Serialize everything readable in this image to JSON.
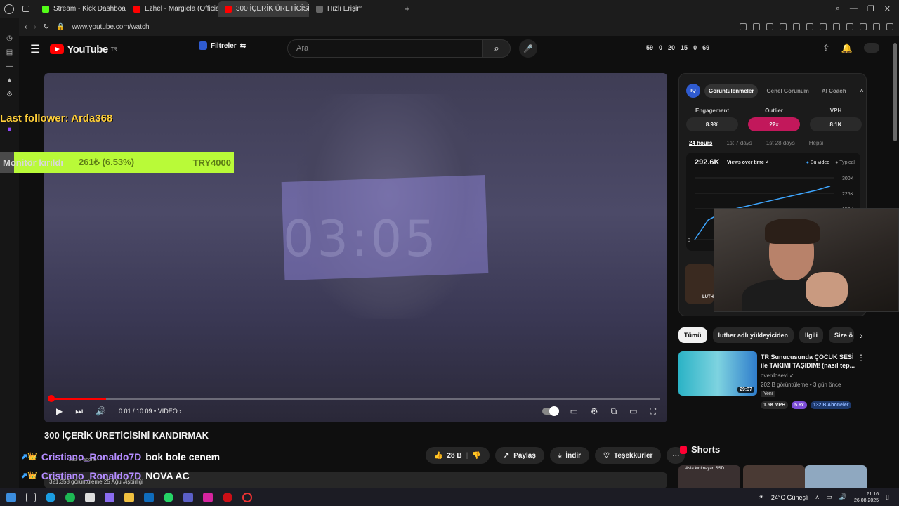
{
  "browser": {
    "tabs": [
      {
        "label": "Stream - Kick Dashboard",
        "color": "#53fc18"
      },
      {
        "label": "Ezhel - Margiela (Official",
        "color": "#ff0000"
      },
      {
        "label": "300 İÇERİK ÜRETİCİSİNİ",
        "color": "#ff0000"
      },
      {
        "label": "Hızlı Erişim",
        "color": "#888888"
      }
    ],
    "active_tab": 2,
    "url": "www.youtube.com/watch"
  },
  "header": {
    "logo_text": "YouTube",
    "logo_region": "TR",
    "filter_label": "Filtreler",
    "search_placeholder": "Ara",
    "stats": [
      "59",
      "0",
      "20",
      "15",
      "0",
      "69"
    ]
  },
  "overlay": {
    "last_follower": "Last follower: Arda368",
    "goal_label": "Monitör kırıldı",
    "goal_amount": "261₺ (6.53%)",
    "goal_target": "TRY4000",
    "goal_progress": 0.0653
  },
  "player": {
    "overlay_time_text": "03:05",
    "time": "0:01 / 10:09",
    "chapter": "VİDEO",
    "progress": 0.0016
  },
  "video": {
    "title": "300 İÇERİK ÜRETİCİSİNİ KANDIRMAK",
    "likes": "28 B",
    "share": "Paylaş",
    "download": "İndir",
    "thanks": "Teşekkürler",
    "subscribers": "255 B abone",
    "views_meta": "321.358 görüntüleme  25 Ağu  #işbirliği"
  },
  "chat": [
    {
      "user": "Cristiano_Ronaldo7D",
      "message": "bok bole cenem"
    },
    {
      "user": "Cristiano_Ronaldo7D",
      "message": "NOVA AC"
    }
  ],
  "iq_panel": {
    "tabs": [
      "Görüntülenmeler",
      "Genel Görünüm",
      "AI Coach"
    ],
    "active_tab": 0,
    "metrics": [
      {
        "label": "Engagement",
        "value": "8.9%"
      },
      {
        "label": "Outlier",
        "value": "22x"
      },
      {
        "label": "VPH",
        "value": "8.1K"
      }
    ],
    "ranges": [
      "24 hours",
      "1st 7 days",
      "1st 28 days",
      "Hepsi"
    ],
    "active_range": 0,
    "total": "292.6K",
    "mode": "Views over time",
    "legend": [
      "Bu video",
      "Typical"
    ],
    "y_ticks": [
      "300K",
      "225K",
      "150K",
      "0"
    ],
    "thumb_label": "LUTH"
  },
  "chart_data": {
    "type": "line",
    "title": "",
    "xlabel": "",
    "ylabel": "",
    "ylim": [
      0,
      300000
    ],
    "x": [
      0,
      1,
      2,
      3,
      4,
      5,
      6,
      7,
      8,
      9,
      10
    ],
    "series": [
      {
        "name": "Bu video",
        "values": [
          0,
          95000,
          130000,
          150000,
          165000,
          180000,
          195000,
          210000,
          225000,
          240000,
          260000
        ]
      }
    ]
  },
  "chips": [
    "Tümü",
    "luther adlı yükleyiciden",
    "İlgili",
    "Size ö"
  ],
  "recommended": {
    "title": "TR Sunucusunda ÇOCUK SESİ ile TAKIMI TAŞIDIM! (nasıl tep...",
    "channel": "overdosevi",
    "meta": "202 B görüntüleme • 3 gün önce",
    "badge": "Yeni",
    "duration": "29:37",
    "vph": "1.5K VPH",
    "outlier": "5.6x",
    "subs": "132 B Aboneler"
  },
  "shorts": {
    "title": "Shorts",
    "first_label": "Asla kırılmayan SSD"
  },
  "taskbar": {
    "weather": "24°C Güneşli",
    "time": "21:16",
    "date": "26.08.2025"
  }
}
